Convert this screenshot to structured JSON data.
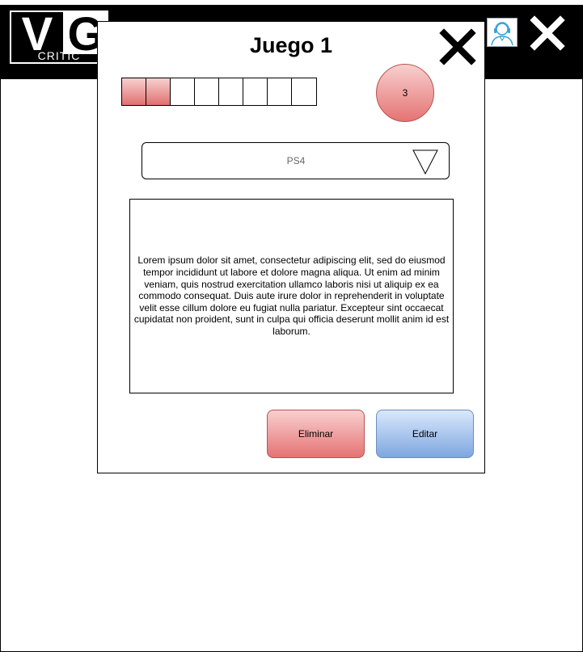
{
  "header": {
    "logo_letter_1": "V",
    "logo_letter_2": "G",
    "logo_subtitle": "CRITIC",
    "avatar_icon": "user-headset-icon",
    "close_icon": "close-icon"
  },
  "modal": {
    "title": "Juego 1",
    "close_icon": "close-icon",
    "rating": {
      "filled": 2,
      "total": 8
    },
    "score": "3",
    "platform": {
      "selected": "PS4",
      "icon": "triangle-down-icon"
    },
    "description": "Lorem ipsum dolor sit amet, consectetur adipiscing elit, sed do eiusmod tempor incididunt ut labore et dolore magna aliqua. Ut enim ad minim veniam, quis nostrud exercitation ullamco laboris nisi ut aliquip ex ea commodo consequat. Duis aute irure dolor in reprehenderit in voluptate velit esse cillum dolore eu fugiat nulla pariatur. Excepteur sint occaecat cupidatat non proident, sunt in culpa qui officia deserunt mollit anim id est laborum.",
    "buttons": {
      "delete_label": "Eliminar",
      "edit_label": "Editar"
    }
  },
  "colors": {
    "header_bg": "#000000",
    "danger": "#e57373",
    "primary": "#7ea6e0"
  }
}
